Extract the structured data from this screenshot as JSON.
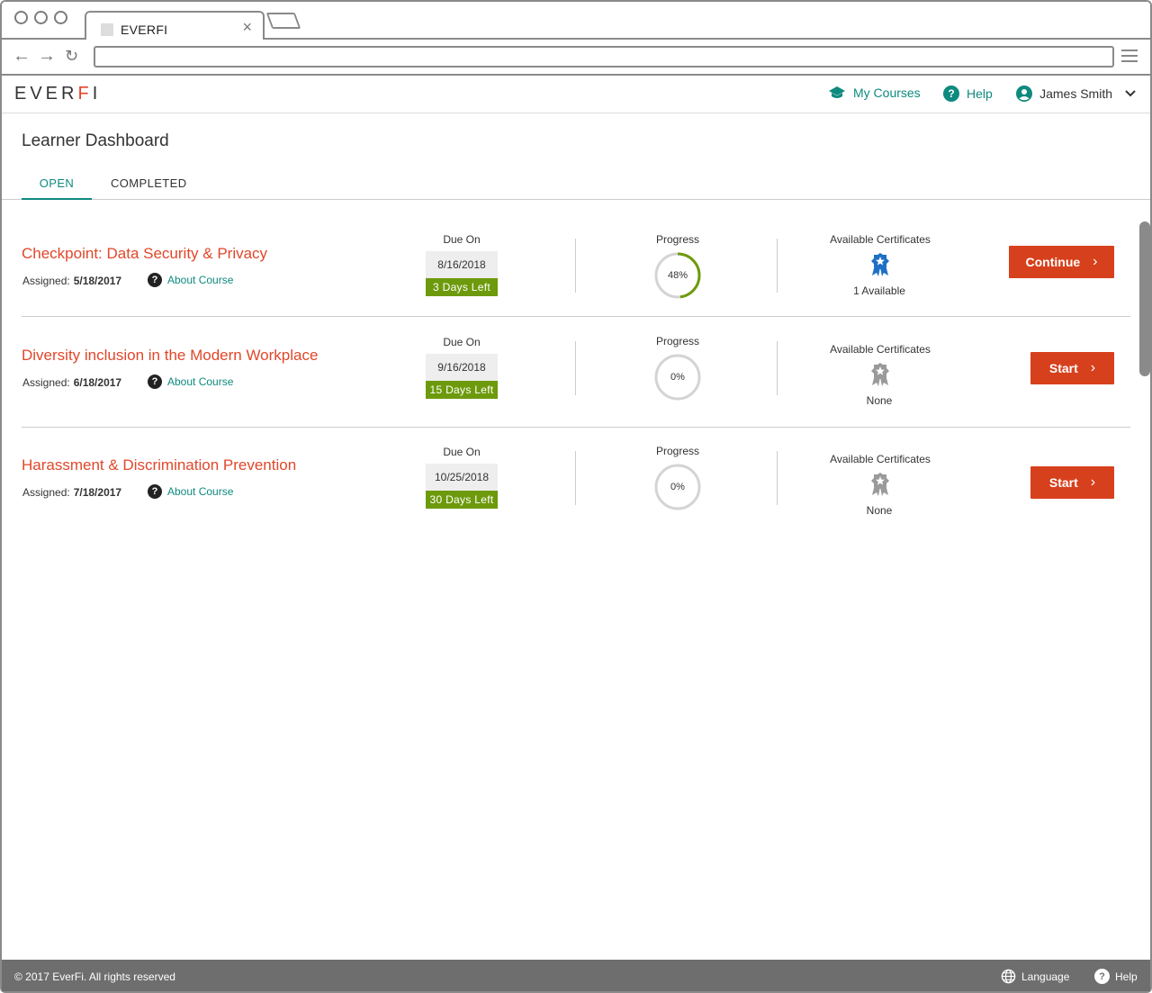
{
  "browser": {
    "tab_title": "EVERFI",
    "url": ""
  },
  "header": {
    "logo": {
      "part1": "EVER",
      "part2": "F",
      "part3": "I"
    },
    "my_courses": "My Courses",
    "help": "Help",
    "user_name": "James Smith"
  },
  "page": {
    "title": "Learner Dashboard",
    "tabs": [
      {
        "label": "OPEN"
      },
      {
        "label": "COMPLETED"
      }
    ]
  },
  "labels": {
    "due_on": "Due On",
    "progress": "Progress",
    "available_certificates": "Available Certificates",
    "assigned": "Assigned:",
    "about_course": "About Course"
  },
  "courses": [
    {
      "title": "Checkpoint: Data Security & Privacy",
      "assigned": "5/18/2017",
      "due_date": "8/16/2018",
      "days_left": "3 Days Left",
      "progress_text": "48%",
      "progress": 0.48,
      "certificates": "1 Available",
      "certificate_available": true,
      "button": "Continue"
    },
    {
      "title": "Diversity inclusion in the Modern Workplace",
      "assigned": "6/18/2017",
      "due_date": "9/16/2018",
      "days_left": "15 Days Left",
      "progress_text": "0%",
      "progress": 0,
      "certificates": "None",
      "certificate_available": false,
      "button": "Start"
    },
    {
      "title": "Harassment & Discrimination Prevention",
      "assigned": "7/18/2017",
      "due_date": "10/25/2018",
      "days_left": "30 Days Left",
      "progress_text": "0%",
      "progress": 0,
      "certificates": "None",
      "certificate_available": false,
      "button": "Start"
    }
  ],
  "footer": {
    "copyright": "© 2017 EverFi. All rights reserved",
    "language": "Language",
    "help": "Help"
  },
  "colors": {
    "accent": "#0e8a7f",
    "brand": "#e1472a",
    "button": "#d7401c",
    "progress": "#6d9a0c",
    "cert_active": "#1f6fc5",
    "cert_inactive": "#9a9a9a"
  },
  "icons": {
    "my_courses": "graduation-cap-icon",
    "help": "question-circle-icon",
    "user": "user-circle-icon",
    "certificate": "award-ribbon-icon",
    "language": "globe-icon"
  }
}
